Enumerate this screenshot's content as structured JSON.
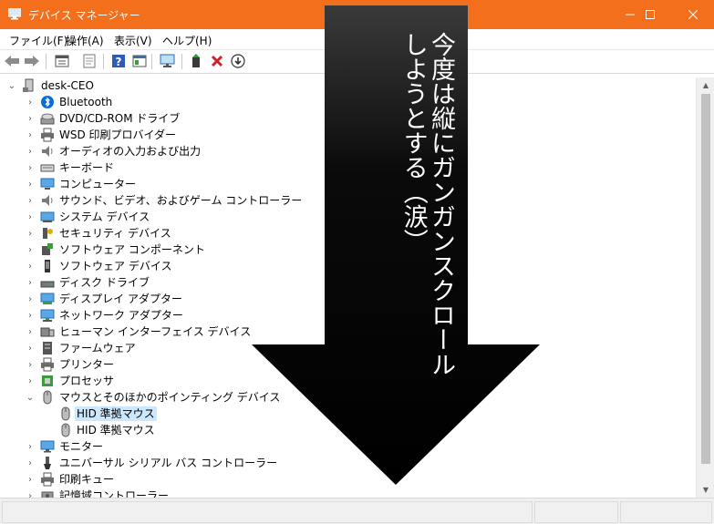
{
  "window": {
    "title": "デバイス マネージャー",
    "minimize_glyph": "—",
    "maximize_glyph": "☐",
    "close_glyph": "✕",
    "titlebar_color": "#f46f1c"
  },
  "menu": [
    "ファイル(F)",
    "操作(A)",
    "表示(V)",
    "ヘルプ(H)"
  ],
  "toolbar": {
    "buttons": [
      "back-icon",
      "forward-icon",
      "properties-icon",
      "show-hidden-icon",
      "help-icon",
      "view-icon",
      "monitor-scan-icon",
      "update-driver-icon",
      "uninstall-icon",
      "disable-icon"
    ]
  },
  "tree": {
    "root": "desk-CEO",
    "items": [
      {
        "label": "Bluetooth",
        "icon": "bluetooth-icon"
      },
      {
        "label": "DVD/CD-ROM ドライブ",
        "icon": "dvd-drive-icon"
      },
      {
        "label": "WSD 印刷プロバイダー",
        "icon": "printer-icon"
      },
      {
        "label": "オーディオの入力および出力",
        "icon": "speaker-icon"
      },
      {
        "label": "キーボード",
        "icon": "keyboard-icon"
      },
      {
        "label": "コンピューター",
        "icon": "computer-icon"
      },
      {
        "label": "サウンド、ビデオ、およびゲーム コントローラー",
        "icon": "speaker-icon"
      },
      {
        "label": "システム デバイス",
        "icon": "system-device-icon"
      },
      {
        "label": "セキュリティ デバイス",
        "icon": "security-key-icon"
      },
      {
        "label": "ソフトウェア コンポーネント",
        "icon": "component-icon"
      },
      {
        "label": "ソフトウェア デバイス",
        "icon": "software-device-icon"
      },
      {
        "label": "ディスク ドライブ",
        "icon": "disk-drive-icon"
      },
      {
        "label": "ディスプレイ アダプター",
        "icon": "display-adapter-icon"
      },
      {
        "label": "ネットワーク アダプター",
        "icon": "network-icon"
      },
      {
        "label": "ヒューマン インターフェイス デバイス",
        "icon": "hid-icon"
      },
      {
        "label": "ファームウェア",
        "icon": "firmware-icon"
      },
      {
        "label": "プリンター",
        "icon": "printer-icon"
      },
      {
        "label": "プロセッサ",
        "icon": "processor-icon"
      },
      {
        "label": "マウスとそのほかのポインティング デバイス",
        "icon": "mouse-icon",
        "expanded": true,
        "children": [
          "HID 準拠マウス",
          "HID 準拠マウス"
        ]
      },
      {
        "label": "モニター",
        "icon": "monitor-icon"
      },
      {
        "label": "ユニバーサル シリアル バス コントローラー",
        "icon": "usb-icon"
      },
      {
        "label": "印刷キュー",
        "icon": "printer-icon"
      },
      {
        "label": "記憶域コントローラー",
        "icon": "storage-icon"
      }
    ]
  },
  "overlay": {
    "text": "今度は縦にガンガンスクロールしようとする（涙）",
    "arrow_color": "#000000",
    "text_color": "#ffffff"
  }
}
